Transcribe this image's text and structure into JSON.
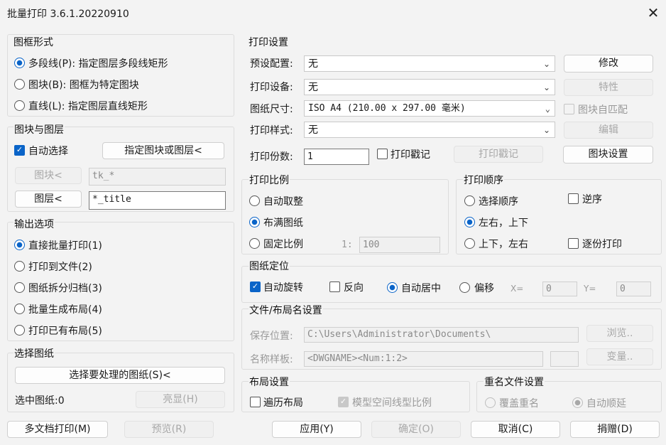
{
  "window": {
    "title": "批量打印 3.6.1.20220910",
    "close_glyph": "✕"
  },
  "frame_type": {
    "title": "图框形式",
    "options": [
      {
        "label": "多段线(P): 指定图层多段线矩形",
        "selected": true
      },
      {
        "label": "图块(B): 图框为特定图块",
        "selected": false
      },
      {
        "label": "直线(L): 指定图层直线矩形",
        "selected": false
      }
    ]
  },
  "block_layer": {
    "title": "图块与图层",
    "auto_select": "自动选择",
    "specify_button": "指定图块或图层<",
    "block_button": "图块<",
    "block_value": "tk_*",
    "layer_button": "图层<",
    "layer_value": "*_title"
  },
  "output": {
    "title": "输出选项",
    "options": [
      {
        "label": "直接批量打印(1)",
        "selected": true
      },
      {
        "label": "打印到文件(2)",
        "selected": false
      },
      {
        "label": "图纸拆分归档(3)",
        "selected": false
      },
      {
        "label": "批量生成布局(4)",
        "selected": false
      },
      {
        "label": "打印已有布局(5)",
        "selected": false
      }
    ]
  },
  "select_drawing": {
    "title": "选择图纸",
    "select_button": "选择要处理的图纸(S)<",
    "selected_label": "选中图纸:0",
    "highlight_button": "亮显(H)"
  },
  "print_settings": {
    "title": "打印设置",
    "preset_label": "预设配置:",
    "preset_value": "无",
    "modify_button": "修改",
    "device_label": "打印设备:",
    "device_value": "无",
    "properties_button": "特性",
    "paper_label": "图纸尺寸:",
    "paper_value": "ISO A4 (210.00 x 297.00 毫米)",
    "auto_match": "图块自匹配",
    "style_label": "打印样式:",
    "style_value": "无",
    "edit_button": "编辑",
    "copies_label": "打印份数:",
    "copies_value": "1",
    "stamp_check": "打印戳记",
    "stamp_button": "打印戳记",
    "block_settings_button": "图块设置"
  },
  "scale": {
    "title": "打印比例",
    "options": [
      {
        "label": "自动取整",
        "selected": false
      },
      {
        "label": "布满图纸",
        "selected": true
      },
      {
        "label": "固定比例",
        "selected": false
      }
    ],
    "ratio_prefix": "1:",
    "ratio_value": "100"
  },
  "order": {
    "title": "打印顺序",
    "select_order": "选择顺序",
    "reverse": "逆序",
    "lr_tb": "左右，上下",
    "tb_lr": "上下，左右",
    "per_copy": "逐份打印"
  },
  "placement": {
    "title": "图纸定位",
    "auto_rotate": "自动旋转",
    "reverse": "反向",
    "auto_center": "自动居中",
    "offset": "偏移",
    "x_label": "X=",
    "x_value": "0",
    "y_label": "Y=",
    "y_value": "0"
  },
  "file_name": {
    "title": "文件/布局名设置",
    "save_label": "保存位置:",
    "save_value": "C:\\Users\\Administrator\\Documents\\",
    "browse_button": "浏览..",
    "template_label": "名称样板:",
    "template_value": "<DWGNAME><Num:1:2>",
    "vars_button": "变量.."
  },
  "layout": {
    "title": "布局设置",
    "traverse": "遍历布局",
    "model_linetype": "模型空间线型比例"
  },
  "rename": {
    "title": "重名文件设置",
    "overwrite": "覆盖重名",
    "auto_increment": "自动顺延"
  },
  "footer": {
    "multi_doc": "多文档打印(M)",
    "preview": "预览(R)",
    "apply": "应用(Y)",
    "ok": "确定(O)",
    "cancel": "取消(C)",
    "donate": "捐赠(D)"
  }
}
